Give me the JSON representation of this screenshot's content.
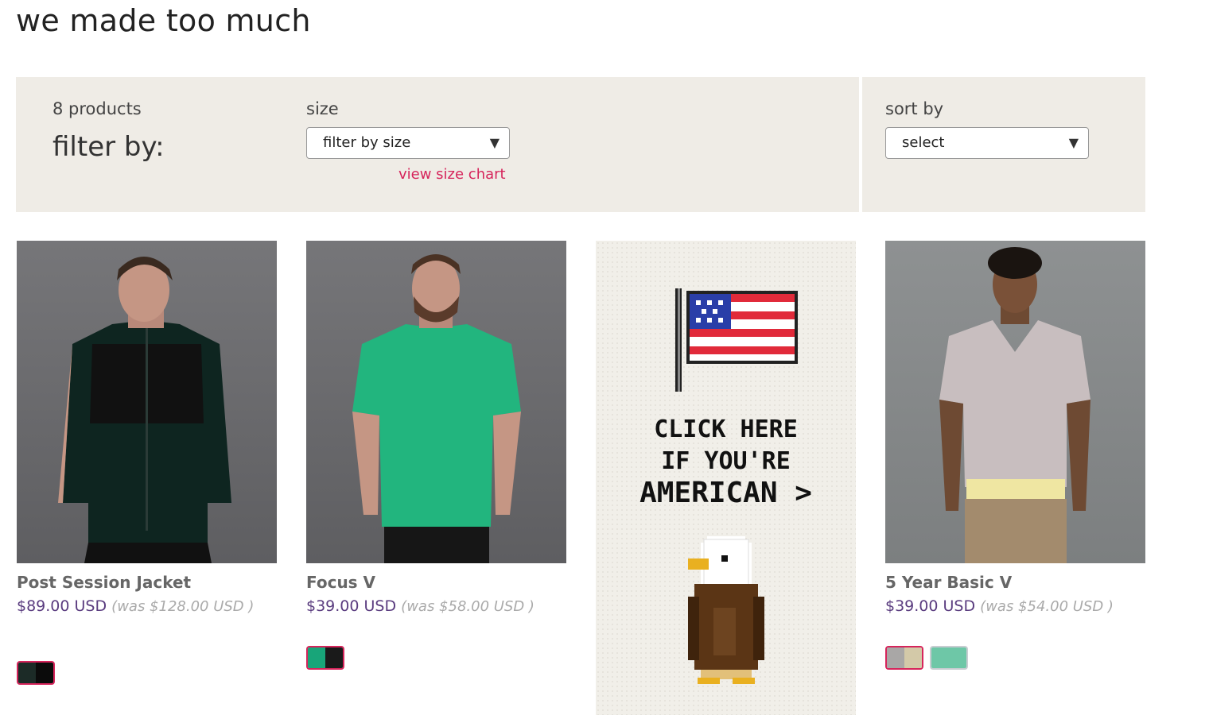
{
  "page": {
    "title": "we made too much"
  },
  "filters": {
    "product_count": "8 products",
    "filter_by_label": "filter by:",
    "size_label": "size",
    "size_select": "filter by size",
    "size_chart_link": "view size chart",
    "sort_label": "sort by",
    "sort_select": "select"
  },
  "products": [
    {
      "name": "Post Session Jacket",
      "price": "$89.00 USD",
      "was": "(was $128.00 USD )",
      "swatches": [
        {
          "colors": [
            "#1c2b27",
            "#0b0b0b"
          ],
          "selected": true
        }
      ]
    },
    {
      "name": "Focus V",
      "price": "$39.00 USD",
      "was": "(was $58.00 USD )",
      "swatches": [
        {
          "colors": [
            "#18a579",
            "#1a1a1a"
          ],
          "selected": true
        }
      ]
    },
    {
      "name": "5 Year Basic V",
      "price": "$39.00 USD",
      "was": "(was $54.00 USD )",
      "swatches": [
        {
          "colors": [
            "#a9a7a6",
            "#d3c9a8"
          ],
          "selected": true
        },
        {
          "colors": [
            "#6ec7a7"
          ],
          "selected": false
        }
      ]
    }
  ],
  "promo": {
    "line1": "CLICK HERE",
    "line2": "IF YOU'RE",
    "line3": "AMERICAN >"
  },
  "colors": {
    "accent_link": "#d6245b",
    "price": "#5a3c7f",
    "filter_bg": "#efece6"
  }
}
